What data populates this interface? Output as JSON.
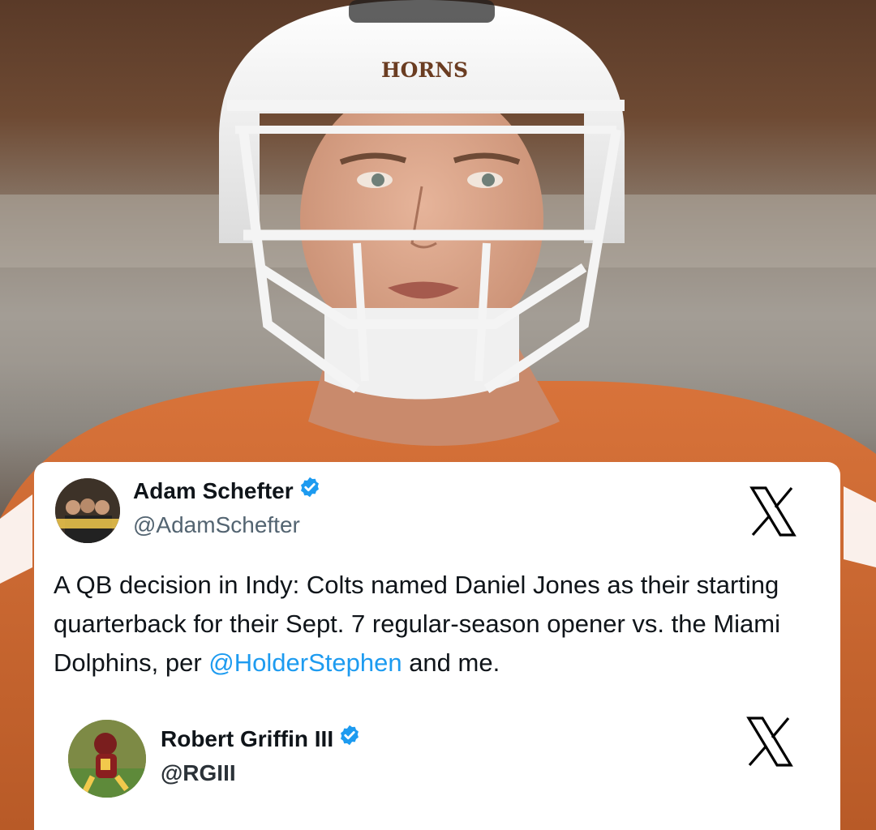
{
  "photo": {
    "helmet_text": "HORNS",
    "colors": {
      "jersey": "#c8642e",
      "helmet": "#f4f4f4",
      "background": "#8a7a6c"
    }
  },
  "tweets": [
    {
      "name": "Adam Schefter",
      "handle": "@AdamSchefter",
      "verified": true,
      "avatar_icon": "avatar-photo",
      "platform_icon": "x-logo-icon",
      "text_before": "A QB decision in Indy: Colts named Daniel Jones as their starting quarterback for their Sept. 7 regular-season opener vs. the Miami Dolphins, per ",
      "mention": "@HolderStephen",
      "text_after": " and me."
    },
    {
      "name": "Robert Griffin III",
      "handle": "@RGIII",
      "verified": true,
      "avatar_icon": "avatar-photo",
      "platform_icon": "x-logo-icon"
    }
  ],
  "colors": {
    "verified_blue": "#1d9bf0",
    "mention_blue": "#1d9bf0",
    "text": "#0f1419",
    "handle": "#536471"
  }
}
